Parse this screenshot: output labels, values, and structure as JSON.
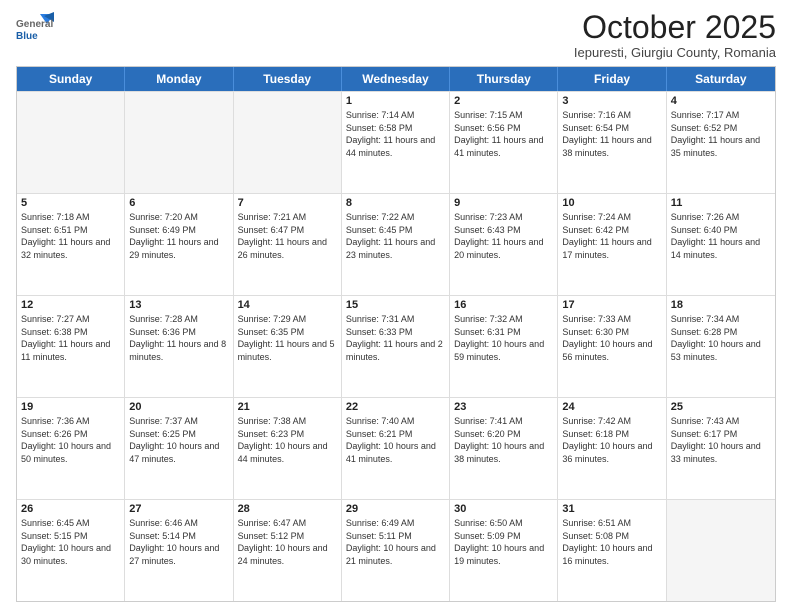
{
  "logo": {
    "general": "General",
    "blue": "Blue"
  },
  "title": "October 2025",
  "location": "Iepuresti, Giurgiu County, Romania",
  "days_of_week": [
    "Sunday",
    "Monday",
    "Tuesday",
    "Wednesday",
    "Thursday",
    "Friday",
    "Saturday"
  ],
  "weeks": [
    [
      {
        "day": "",
        "text": ""
      },
      {
        "day": "",
        "text": ""
      },
      {
        "day": "",
        "text": ""
      },
      {
        "day": "1",
        "text": "Sunrise: 7:14 AM\nSunset: 6:58 PM\nDaylight: 11 hours and 44 minutes."
      },
      {
        "day": "2",
        "text": "Sunrise: 7:15 AM\nSunset: 6:56 PM\nDaylight: 11 hours and 41 minutes."
      },
      {
        "day": "3",
        "text": "Sunrise: 7:16 AM\nSunset: 6:54 PM\nDaylight: 11 hours and 38 minutes."
      },
      {
        "day": "4",
        "text": "Sunrise: 7:17 AM\nSunset: 6:52 PM\nDaylight: 11 hours and 35 minutes."
      }
    ],
    [
      {
        "day": "5",
        "text": "Sunrise: 7:18 AM\nSunset: 6:51 PM\nDaylight: 11 hours and 32 minutes."
      },
      {
        "day": "6",
        "text": "Sunrise: 7:20 AM\nSunset: 6:49 PM\nDaylight: 11 hours and 29 minutes."
      },
      {
        "day": "7",
        "text": "Sunrise: 7:21 AM\nSunset: 6:47 PM\nDaylight: 11 hours and 26 minutes."
      },
      {
        "day": "8",
        "text": "Sunrise: 7:22 AM\nSunset: 6:45 PM\nDaylight: 11 hours and 23 minutes."
      },
      {
        "day": "9",
        "text": "Sunrise: 7:23 AM\nSunset: 6:43 PM\nDaylight: 11 hours and 20 minutes."
      },
      {
        "day": "10",
        "text": "Sunrise: 7:24 AM\nSunset: 6:42 PM\nDaylight: 11 hours and 17 minutes."
      },
      {
        "day": "11",
        "text": "Sunrise: 7:26 AM\nSunset: 6:40 PM\nDaylight: 11 hours and 14 minutes."
      }
    ],
    [
      {
        "day": "12",
        "text": "Sunrise: 7:27 AM\nSunset: 6:38 PM\nDaylight: 11 hours and 11 minutes."
      },
      {
        "day": "13",
        "text": "Sunrise: 7:28 AM\nSunset: 6:36 PM\nDaylight: 11 hours and 8 minutes."
      },
      {
        "day": "14",
        "text": "Sunrise: 7:29 AM\nSunset: 6:35 PM\nDaylight: 11 hours and 5 minutes."
      },
      {
        "day": "15",
        "text": "Sunrise: 7:31 AM\nSunset: 6:33 PM\nDaylight: 11 hours and 2 minutes."
      },
      {
        "day": "16",
        "text": "Sunrise: 7:32 AM\nSunset: 6:31 PM\nDaylight: 10 hours and 59 minutes."
      },
      {
        "day": "17",
        "text": "Sunrise: 7:33 AM\nSunset: 6:30 PM\nDaylight: 10 hours and 56 minutes."
      },
      {
        "day": "18",
        "text": "Sunrise: 7:34 AM\nSunset: 6:28 PM\nDaylight: 10 hours and 53 minutes."
      }
    ],
    [
      {
        "day": "19",
        "text": "Sunrise: 7:36 AM\nSunset: 6:26 PM\nDaylight: 10 hours and 50 minutes."
      },
      {
        "day": "20",
        "text": "Sunrise: 7:37 AM\nSunset: 6:25 PM\nDaylight: 10 hours and 47 minutes."
      },
      {
        "day": "21",
        "text": "Sunrise: 7:38 AM\nSunset: 6:23 PM\nDaylight: 10 hours and 44 minutes."
      },
      {
        "day": "22",
        "text": "Sunrise: 7:40 AM\nSunset: 6:21 PM\nDaylight: 10 hours and 41 minutes."
      },
      {
        "day": "23",
        "text": "Sunrise: 7:41 AM\nSunset: 6:20 PM\nDaylight: 10 hours and 38 minutes."
      },
      {
        "day": "24",
        "text": "Sunrise: 7:42 AM\nSunset: 6:18 PM\nDaylight: 10 hours and 36 minutes."
      },
      {
        "day": "25",
        "text": "Sunrise: 7:43 AM\nSunset: 6:17 PM\nDaylight: 10 hours and 33 minutes."
      }
    ],
    [
      {
        "day": "26",
        "text": "Sunrise: 6:45 AM\nSunset: 5:15 PM\nDaylight: 10 hours and 30 minutes."
      },
      {
        "day": "27",
        "text": "Sunrise: 6:46 AM\nSunset: 5:14 PM\nDaylight: 10 hours and 27 minutes."
      },
      {
        "day": "28",
        "text": "Sunrise: 6:47 AM\nSunset: 5:12 PM\nDaylight: 10 hours and 24 minutes."
      },
      {
        "day": "29",
        "text": "Sunrise: 6:49 AM\nSunset: 5:11 PM\nDaylight: 10 hours and 21 minutes."
      },
      {
        "day": "30",
        "text": "Sunrise: 6:50 AM\nSunset: 5:09 PM\nDaylight: 10 hours and 19 minutes."
      },
      {
        "day": "31",
        "text": "Sunrise: 6:51 AM\nSunset: 5:08 PM\nDaylight: 10 hours and 16 minutes."
      },
      {
        "day": "",
        "text": ""
      }
    ]
  ]
}
